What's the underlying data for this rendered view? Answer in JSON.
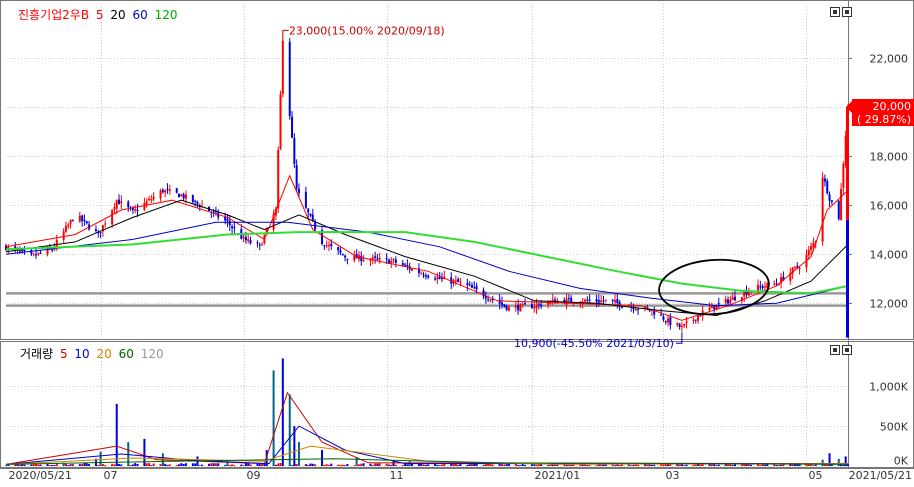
{
  "legend": {
    "stock_name": "진흥기업2우B",
    "ma_prefix": [
      "5",
      "20",
      "60",
      "120"
    ],
    "ma_colors": [
      "#ff0000",
      "#000000",
      "#0000cc",
      "#00cc00"
    ]
  },
  "volume_legend": {
    "title": "거래량",
    "ma_labels": [
      "5",
      "10",
      "20",
      "60",
      "120"
    ],
    "ma_colors": [
      "#cc0000",
      "#0000cc",
      "#cc8800",
      "#006600",
      "#999999"
    ]
  },
  "annotations": {
    "high": "23,000(15.00% 2020/09/18)",
    "low": "10,900(-45.50% 2021/03/10)",
    "current_price": "20,000",
    "current_pct": "( 29.87%)"
  },
  "colors": {
    "up": "#ff0000",
    "down": "#0000dd",
    "ma120": "#33dd33",
    "support": "#999999"
  },
  "chart_data": [
    {
      "type": "candlestick",
      "title": "진흥기업2우B",
      "ylim": [
        10500,
        24200
      ],
      "y_ticks": [
        12000,
        14000,
        16000,
        18000,
        20000,
        22000
      ],
      "y_tick_labels": [
        "12,000",
        "14,000",
        "16,000",
        "18,000",
        "20,000",
        "22,000"
      ],
      "x_range": [
        "2020/05/21",
        "2021/05/21"
      ],
      "x_tick_labels": [
        "2020/05/21",
        "07",
        "09",
        "11",
        "2021/01",
        "03",
        "05",
        "2021/05/21"
      ],
      "x_tick_dates": [
        "2020-05-21",
        "2020-07-01",
        "2020-09-01",
        "2020-11-02",
        "2021-01-04",
        "2021-03-02",
        "2021-05-03",
        "2021-05-21"
      ],
      "horizontal_lines": [
        12400,
        11900
      ],
      "close_points": [
        [
          "2020-05-21",
          14300
        ],
        [
          "2020-06-01",
          13900
        ],
        [
          "2020-06-10",
          14200
        ],
        [
          "2020-06-20",
          15600
        ],
        [
          "2020-06-30",
          14800
        ],
        [
          "2020-07-08",
          16200
        ],
        [
          "2020-07-15",
          15700
        ],
        [
          "2020-07-28",
          16600
        ],
        [
          "2020-08-05",
          16400
        ],
        [
          "2020-08-15",
          15900
        ],
        [
          "2020-08-25",
          15300
        ],
        [
          "2020-09-01",
          14600
        ],
        [
          "2020-09-08",
          14300
        ],
        [
          "2020-09-15",
          15800
        ],
        [
          "2020-09-18",
          22800
        ],
        [
          "2020-09-24",
          16600
        ],
        [
          "2020-10-05",
          14500
        ],
        [
          "2020-10-15",
          13900
        ],
        [
          "2020-10-25",
          13800
        ],
        [
          "2020-11-05",
          13700
        ],
        [
          "2020-11-15",
          13300
        ],
        [
          "2020-11-25",
          13000
        ],
        [
          "2020-12-05",
          12800
        ],
        [
          "2020-12-15",
          12300
        ],
        [
          "2020-12-25",
          11800
        ],
        [
          "2021-01-05",
          11900
        ],
        [
          "2021-01-15",
          12100
        ],
        [
          "2021-01-25",
          12100
        ],
        [
          "2021-02-05",
          12100
        ],
        [
          "2021-02-15",
          11900
        ],
        [
          "2021-02-25",
          11700
        ],
        [
          "2021-03-05",
          11200
        ],
        [
          "2021-03-10",
          11000
        ],
        [
          "2021-03-20",
          11700
        ],
        [
          "2021-03-30",
          12100
        ],
        [
          "2021-04-10",
          12600
        ],
        [
          "2021-04-20",
          12800
        ],
        [
          "2021-04-25",
          13200
        ],
        [
          "2021-05-01",
          13600
        ],
        [
          "2021-05-07",
          14600
        ],
        [
          "2021-05-10",
          17200
        ],
        [
          "2021-05-13",
          16300
        ],
        [
          "2021-05-17",
          15500
        ],
        [
          "2021-05-21",
          20000
        ]
      ],
      "ma_series": [
        {
          "name": "5",
          "color": "#ff0000",
          "points": [
            [
              "2020-05-21",
              14300
            ],
            [
              "2020-06-20",
              14800
            ],
            [
              "2020-07-10",
              15800
            ],
            [
              "2020-08-01",
              16200
            ],
            [
              "2020-08-25",
              15500
            ],
            [
              "2020-09-10",
              14600
            ],
            [
              "2020-09-21",
              17200
            ],
            [
              "2020-10-01",
              15000
            ],
            [
              "2020-10-20",
              13900
            ],
            [
              "2020-11-20",
              13300
            ],
            [
              "2020-12-20",
              12100
            ],
            [
              "2021-01-20",
              12000
            ],
            [
              "2021-02-20",
              11900
            ],
            [
              "2021-03-10",
              11300
            ],
            [
              "2021-03-30",
              11900
            ],
            [
              "2021-04-20",
              12700
            ],
            [
              "2021-05-05",
              13900
            ],
            [
              "2021-05-12",
              15800
            ],
            [
              "2021-05-21",
              16600
            ]
          ]
        },
        {
          "name": "20",
          "color": "#000000",
          "points": [
            [
              "2020-05-21",
              14100
            ],
            [
              "2020-06-20",
              14500
            ],
            [
              "2020-07-15",
              15500
            ],
            [
              "2020-08-05",
              16200
            ],
            [
              "2020-08-25",
              15600
            ],
            [
              "2020-09-10",
              15000
            ],
            [
              "2020-09-25",
              15600
            ],
            [
              "2020-10-15",
              14800
            ],
            [
              "2020-11-10",
              13900
            ],
            [
              "2020-12-10",
              13100
            ],
            [
              "2021-01-05",
              12100
            ],
            [
              "2021-02-01",
              12000
            ],
            [
              "2021-03-01",
              11700
            ],
            [
              "2021-03-25",
              11500
            ],
            [
              "2021-04-15",
              12100
            ],
            [
              "2021-05-05",
              12900
            ],
            [
              "2021-05-21",
              14400
            ]
          ]
        },
        {
          "name": "60",
          "color": "#0000cc",
          "points": [
            [
              "2020-05-21",
              14000
            ],
            [
              "2020-07-15",
              14600
            ],
            [
              "2020-08-20",
              15300
            ],
            [
              "2020-09-20",
              15300
            ],
            [
              "2020-10-25",
              14900
            ],
            [
              "2020-11-25",
              14300
            ],
            [
              "2020-12-25",
              13300
            ],
            [
              "2021-01-25",
              12600
            ],
            [
              "2021-02-25",
              12200
            ],
            [
              "2021-03-25",
              11900
            ],
            [
              "2021-04-20",
              12000
            ],
            [
              "2021-05-21",
              12700
            ]
          ]
        },
        {
          "name": "120",
          "color": "#33dd33",
          "points": [
            [
              "2020-05-21",
              14200
            ],
            [
              "2020-07-15",
              14400
            ],
            [
              "2020-08-25",
              14800
            ],
            [
              "2020-09-25",
              14900
            ],
            [
              "2020-11-10",
              14900
            ],
            [
              "2020-12-10",
              14500
            ],
            [
              "2021-01-10",
              13900
            ],
            [
              "2021-02-10",
              13300
            ],
            [
              "2021-03-10",
              12800
            ],
            [
              "2021-04-05",
              12500
            ],
            [
              "2021-05-05",
              12400
            ],
            [
              "2021-05-21",
              12700
            ]
          ]
        }
      ]
    },
    {
      "type": "bar",
      "title": "거래량",
      "ylim": [
        0,
        1380000
      ],
      "y_ticks": [
        0,
        500000,
        1000000
      ],
      "y_tick_labels": [
        "0K",
        "500K",
        "1,000K"
      ],
      "spikes": [
        [
          "2020-06-15",
          40000
        ],
        [
          "2020-06-29",
          90000
        ],
        [
          "2020-07-01",
          180000
        ],
        [
          "2020-07-08",
          780000
        ],
        [
          "2020-07-13",
          300000
        ],
        [
          "2020-07-20",
          340000
        ],
        [
          "2020-07-28",
          160000
        ],
        [
          "2020-08-12",
          120000
        ],
        [
          "2020-08-25",
          60000
        ],
        [
          "2020-09-11",
          200000
        ],
        [
          "2020-09-14",
          1200000
        ],
        [
          "2020-09-18",
          1350000
        ],
        [
          "2020-09-21",
          900000
        ],
        [
          "2020-09-23",
          500000
        ],
        [
          "2020-09-25",
          300000
        ],
        [
          "2020-10-05",
          200000
        ],
        [
          "2020-10-20",
          110000
        ],
        [
          "2020-11-05",
          70000
        ],
        [
          "2020-11-12",
          60000
        ],
        [
          "2020-12-10",
          40000
        ],
        [
          "2021-01-05",
          30000
        ],
        [
          "2021-03-10",
          30000
        ],
        [
          "2021-05-10",
          80000
        ],
        [
          "2021-05-13",
          160000
        ],
        [
          "2021-05-17",
          90000
        ],
        [
          "2021-05-20",
          120000
        ]
      ]
    }
  ]
}
